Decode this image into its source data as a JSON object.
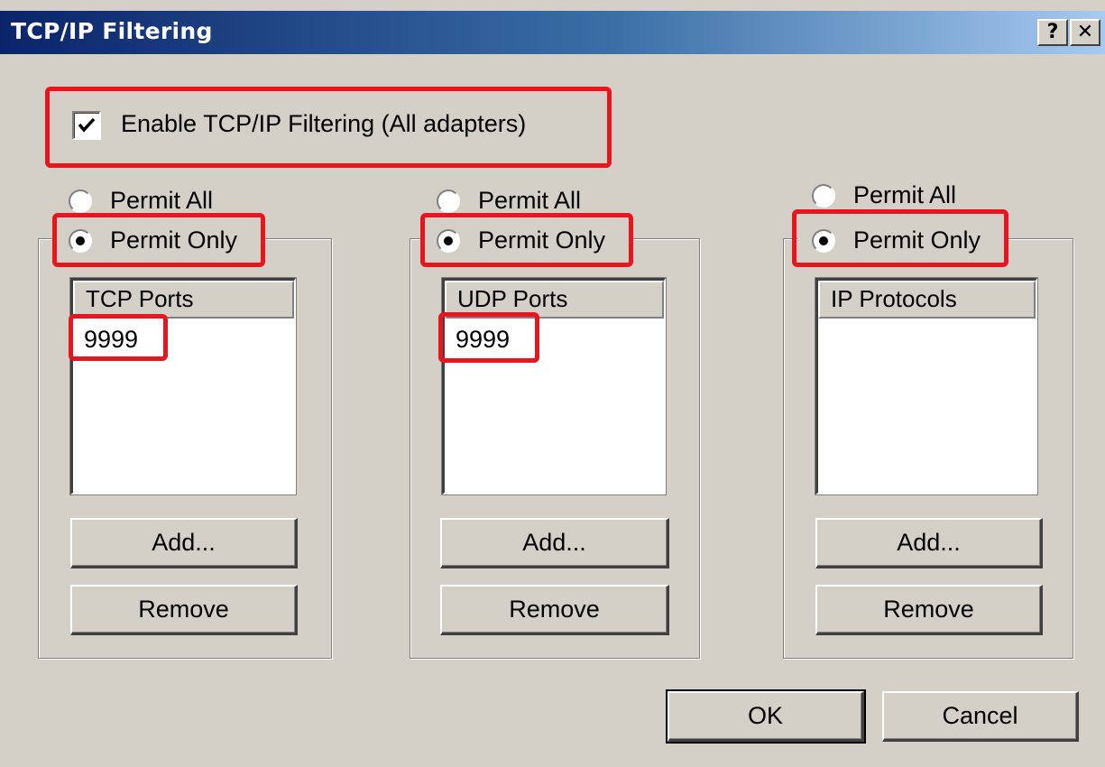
{
  "window": {
    "title": "TCP/IP Filtering",
    "help_button": "?",
    "close_button": "✕"
  },
  "enable_filter": {
    "label": "Enable TCP/IP Filtering (All adapters)",
    "checked": true
  },
  "panels": [
    {
      "permit_all_label": "Permit All",
      "permit_only_label": "Permit Only",
      "selected": "Permit Only",
      "list_header": "TCP Ports",
      "items": [
        "9999"
      ],
      "add_label": "Add...",
      "remove_label": "Remove"
    },
    {
      "permit_all_label": "Permit All",
      "permit_only_label": "Permit Only",
      "selected": "Permit Only",
      "list_header": "UDP Ports",
      "items": [
        "9999"
      ],
      "add_label": "Add...",
      "remove_label": "Remove"
    },
    {
      "permit_all_label": "Permit All",
      "permit_only_label": "Permit Only",
      "selected": "Permit Only",
      "list_header": "IP Protocols",
      "items": [],
      "add_label": "Add...",
      "remove_label": "Remove"
    }
  ],
  "footer": {
    "ok_label": "OK",
    "cancel_label": "Cancel"
  },
  "colors": {
    "highlight": "#e8151f",
    "face": "#d4d0c8",
    "title_start": "#0a246a"
  }
}
